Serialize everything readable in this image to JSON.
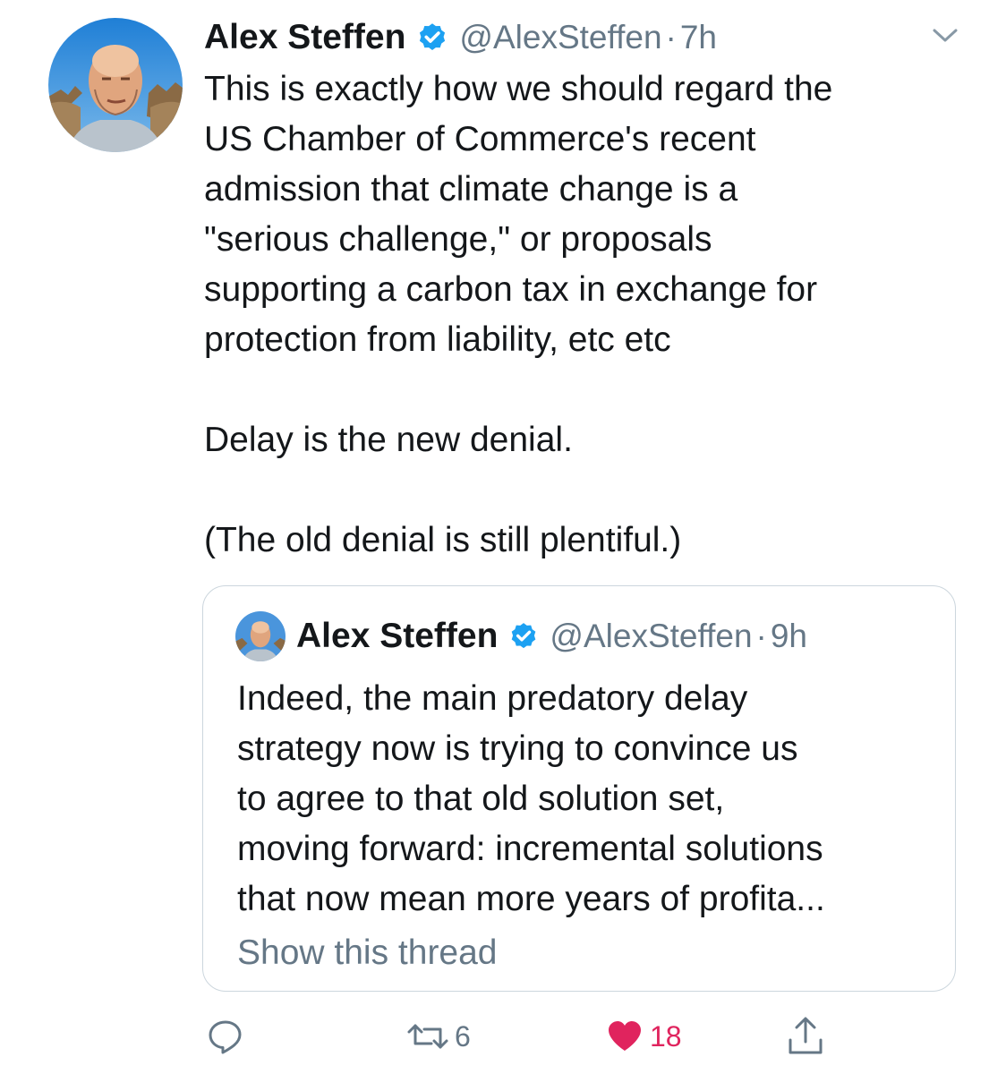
{
  "tweet": {
    "author_name": "Alex Steffen",
    "handle": "@AlexSteffen",
    "separator": "·",
    "time": "7h",
    "lines": [
      "This is exactly how we should regard the",
      "US Chamber of Commerce's recent",
      "admission that climate change is a",
      "\"serious challenge,\" or proposals",
      "supporting a carbon tax in exchange for",
      "protection from liability, etc etc"
    ],
    "para2": "Delay is the new denial.",
    "para3": "(The old denial is still plentiful.)"
  },
  "quoted": {
    "author_name": "Alex Steffen",
    "handle": "@AlexSteffen",
    "separator": "·",
    "time": "9h",
    "lines": [
      "Indeed, the main predatory delay",
      "strategy now is trying to convince us",
      "to agree to that old solution set,",
      "moving forward: incremental solutions",
      "that now mean more years of profita..."
    ],
    "show_thread": "Show this thread"
  },
  "actions": {
    "reply_icon": "reply-icon",
    "retweet_icon": "retweet-icon",
    "retweet_count": "6",
    "like_icon": "heart-icon",
    "like_count": "18",
    "share_icon": "share-icon"
  },
  "colors": {
    "verified": "#1da1f2",
    "secondary_text": "#657786",
    "like": "#e0245e",
    "border": "#ccd6dd"
  }
}
